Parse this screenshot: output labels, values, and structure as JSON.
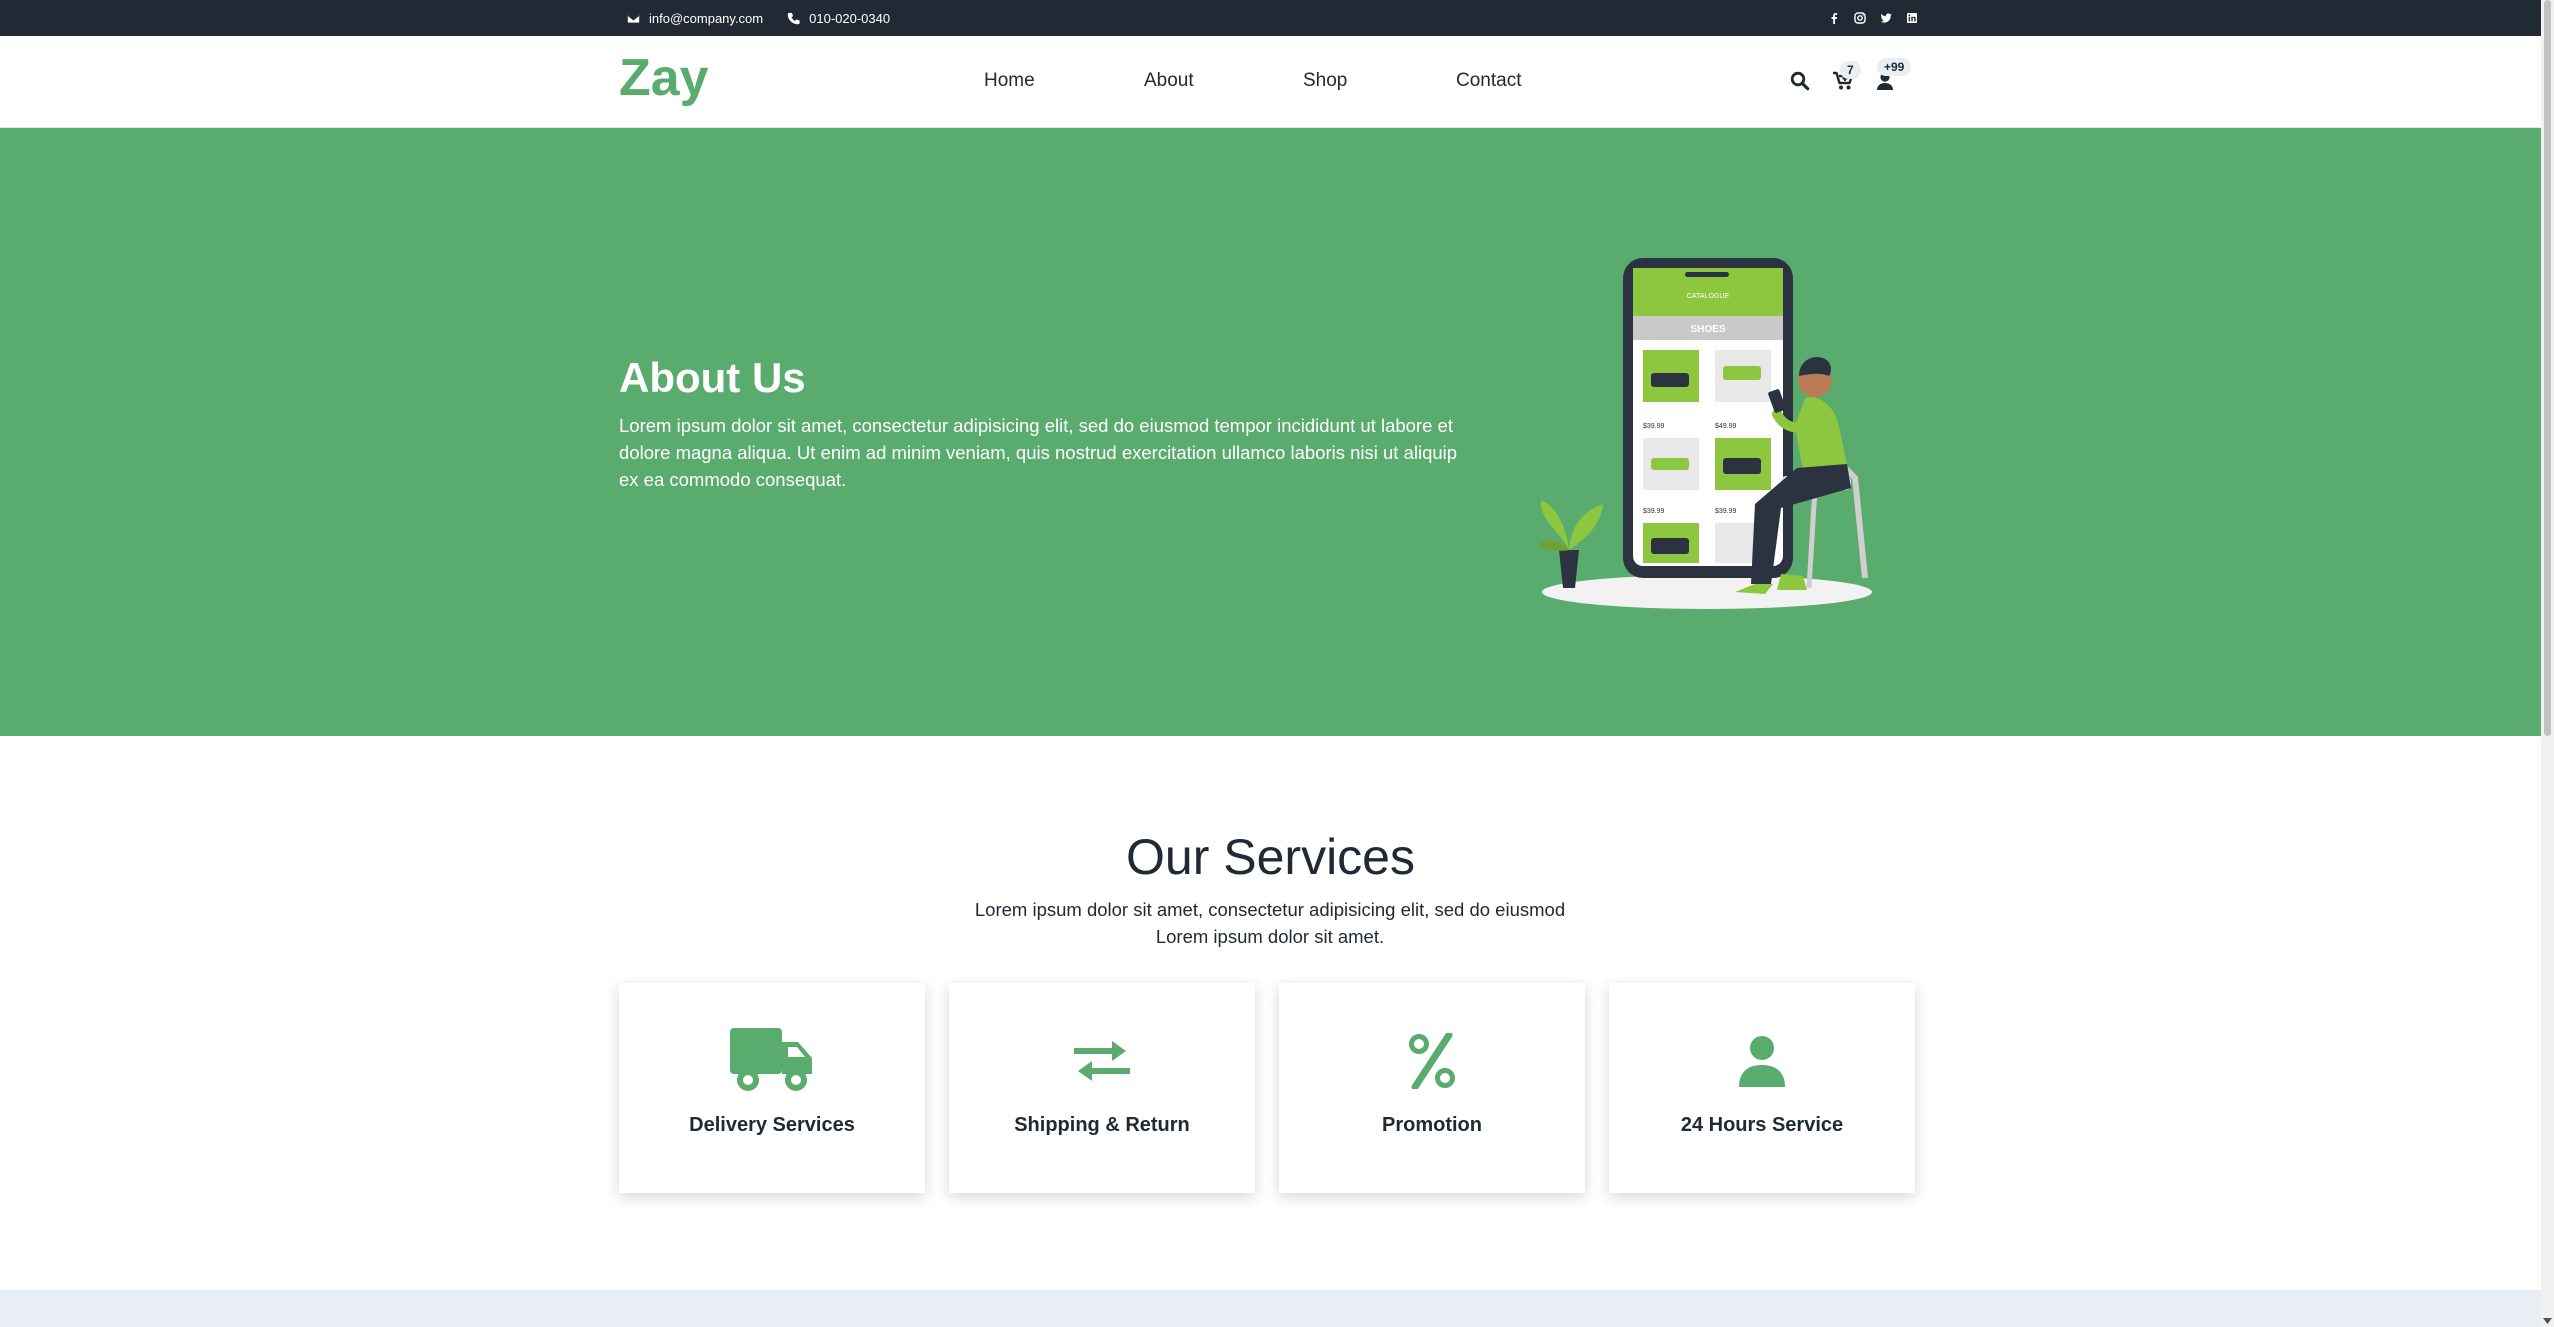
{
  "topbar": {
    "email": "info@company.com",
    "phone": "010-020-0340",
    "social_icons": [
      "facebook-icon",
      "instagram-icon",
      "twitter-icon",
      "linkedin-icon"
    ]
  },
  "navbar": {
    "logo": "Zay",
    "links": [
      "Home",
      "About",
      "Shop",
      "Contact"
    ],
    "cart_count": "7",
    "user_count": "+99",
    "icons": [
      "search-icon",
      "cart-icon",
      "user-icon"
    ]
  },
  "hero": {
    "title": "About Us",
    "text": "Lorem ipsum dolor sit amet, consectetur adipisicing elit, sed do eiusmod tempor incididunt ut labore et dolore magna aliqua. Ut enim ad minim veniam, quis nostrud exercitation ullamco laboris nisi ut aliquip ex ea commodo consequat.",
    "illustration": {
      "catalogue_label": "CATALOGUE",
      "category": "SHOES",
      "prices": [
        "$39.99",
        "$49.99",
        "$39.99",
        "$39.99"
      ]
    }
  },
  "services": {
    "title": "Our Services",
    "description": "Lorem ipsum dolor sit amet, consectetur adipisicing elit, sed do eiusmod Lorem ipsum dolor sit amet.",
    "cards": [
      {
        "label": "Delivery Services",
        "icon": "truck-icon"
      },
      {
        "label": "Shipping & Return",
        "icon": "exchange-icon"
      },
      {
        "label": "Promotion",
        "icon": "percent-icon"
      },
      {
        "label": "24 Hours Service",
        "icon": "user-icon"
      }
    ]
  },
  "colors": {
    "brand_green": "#59ab6e",
    "dark": "#212934",
    "light_strip": "#e9eef5"
  }
}
